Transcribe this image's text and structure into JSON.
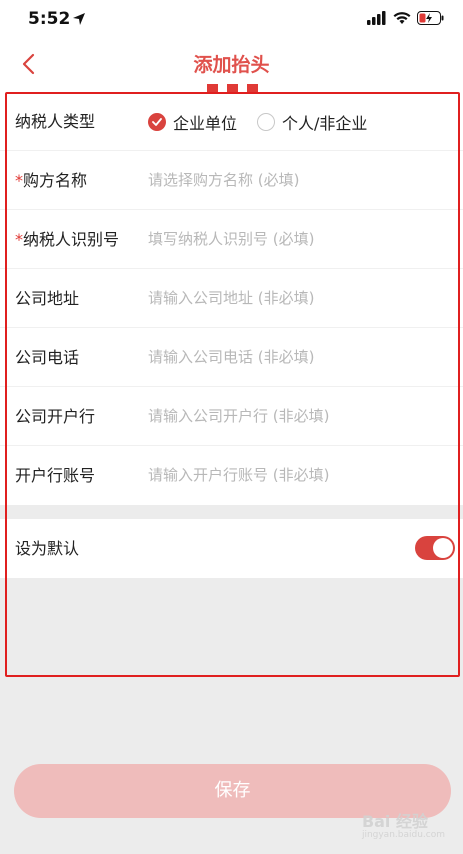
{
  "status_bar": {
    "time": "5:52"
  },
  "nav": {
    "title": "添加抬头"
  },
  "form": {
    "taxpayer_type": {
      "label": "纳税人类型",
      "options": [
        {
          "label": "企业单位",
          "checked": true
        },
        {
          "label": "个人/非企业",
          "checked": false
        }
      ]
    },
    "buyer_name": {
      "required_mark": "*",
      "label": "购方名称",
      "placeholder": "请选择购方名称 (必填)"
    },
    "tax_id": {
      "required_mark": "*",
      "label": "纳税人识别号",
      "placeholder": "填写纳税人识别号 (必填)"
    },
    "company_address": {
      "label": "公司地址",
      "placeholder": "请输入公司地址 (非必填)"
    },
    "company_phone": {
      "label": "公司电话",
      "placeholder": "请输入公司电话 (非必填)"
    },
    "company_bank": {
      "label": "公司开户行",
      "placeholder": "请输入公司开户行 (非必填)"
    },
    "bank_account": {
      "label": "开户行账号",
      "placeholder": "请输入开户行账号 (非必填)"
    }
  },
  "default_setting": {
    "label": "设为默认",
    "enabled": true
  },
  "save_button": {
    "label": "保存"
  },
  "watermark": {
    "text": "Bai 经验",
    "sub": "jingyan.baidu.com"
  },
  "colors": {
    "accent": "#d9433e",
    "title": "#e0514c",
    "highlight_box": "#e01f1f",
    "save_button_bg": "#efbcbb",
    "page_bg": "#ececec"
  }
}
